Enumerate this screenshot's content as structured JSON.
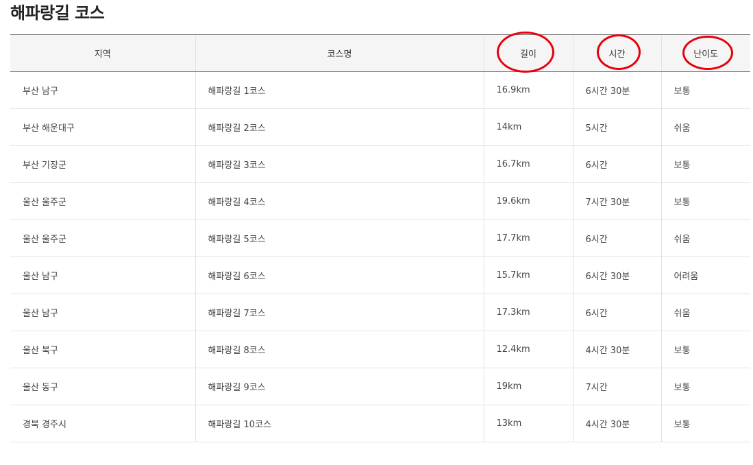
{
  "page": {
    "title": "해파랑길 코스"
  },
  "table": {
    "headers": {
      "region": "지역",
      "course_name": "코스명",
      "length": "길이",
      "time": "시간",
      "difficulty": "난이도"
    },
    "rows": [
      {
        "region": "부산 남구",
        "course_name": "해파랑길 1코스",
        "length": "16.9km",
        "time": "6시간 30분",
        "difficulty": "보통"
      },
      {
        "region": "부산 해운대구",
        "course_name": "해파랑길 2코스",
        "length": "14km",
        "time": "5시간",
        "difficulty": "쉬움"
      },
      {
        "region": "부산 기장군",
        "course_name": "해파랑길 3코스",
        "length": "16.7km",
        "time": "6시간",
        "difficulty": "보통"
      },
      {
        "region": "울산 울주군",
        "course_name": "해파랑길 4코스",
        "length": "19.6km",
        "time": "7시간 30분",
        "difficulty": "보통"
      },
      {
        "region": "울산 울주군",
        "course_name": "해파랑길 5코스",
        "length": "17.7km",
        "time": "6시간",
        "difficulty": "쉬움"
      },
      {
        "region": "울산 남구",
        "course_name": "해파랑길 6코스",
        "length": "15.7km",
        "time": "6시간 30분",
        "difficulty": "어려움"
      },
      {
        "region": "울산 남구",
        "course_name": "해파랑길 7코스",
        "length": "17.3km",
        "time": "6시간",
        "difficulty": "쉬움"
      },
      {
        "region": "울산 북구",
        "course_name": "해파랑길 8코스",
        "length": "12.4km",
        "time": "4시간 30분",
        "difficulty": "보통"
      },
      {
        "region": "울산 동구",
        "course_name": "해파랑길 9코스",
        "length": "19km",
        "time": "7시간",
        "difficulty": "보통"
      },
      {
        "region": "경북 경주시",
        "course_name": "해파랑길 10코스",
        "length": "13km",
        "time": "4시간 30분",
        "difficulty": "보통"
      }
    ]
  },
  "annotation": {
    "circle_color": "#e8000b"
  }
}
